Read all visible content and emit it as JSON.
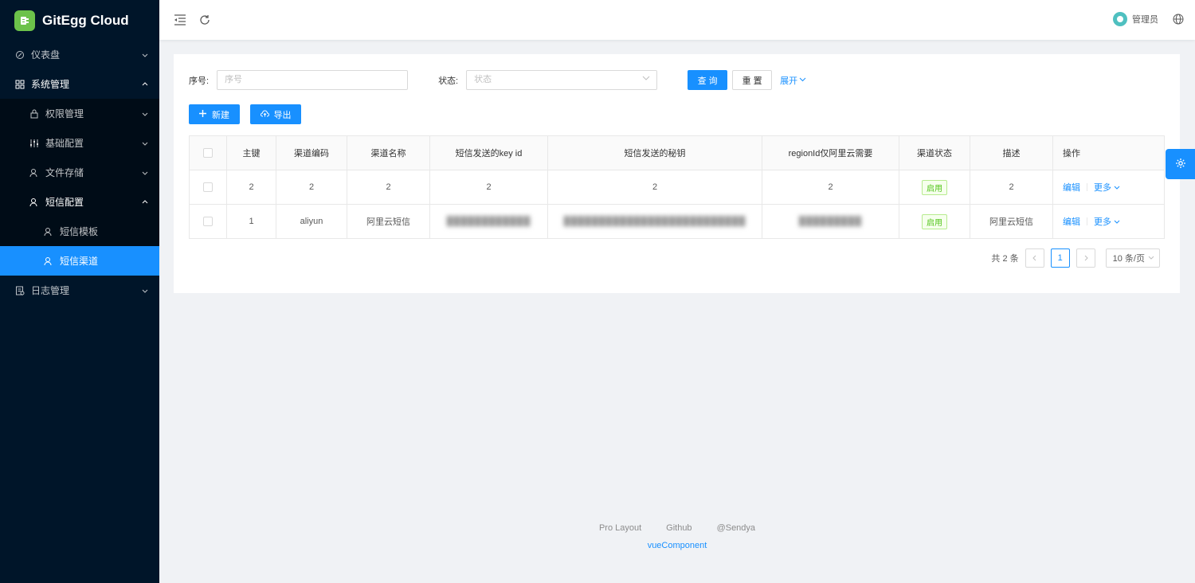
{
  "app": {
    "title": "GitEgg Cloud",
    "accent": "#1890ff",
    "sider_bg": "#001529"
  },
  "sidebar": {
    "items": [
      {
        "label": "仪表盘",
        "icon": "dashboard-icon",
        "arrow": "chevron-down"
      },
      {
        "label": "系统管理",
        "icon": "appstore-icon",
        "arrow": "chevron-up"
      },
      {
        "label": "权限管理",
        "icon": "lock-icon",
        "arrow": "chevron-down"
      },
      {
        "label": "基础配置",
        "icon": "sliders-icon",
        "arrow": "chevron-down"
      },
      {
        "label": "文件存储",
        "icon": "user-icon",
        "arrow": "chevron-down"
      },
      {
        "label": "短信配置",
        "icon": "user-icon",
        "arrow": "chevron-up"
      },
      {
        "label": "短信模板",
        "icon": "user-icon"
      },
      {
        "label": "短信渠道",
        "icon": "user-icon",
        "selected": true
      },
      {
        "label": "日志管理",
        "icon": "log-icon",
        "arrow": "chevron-down"
      }
    ]
  },
  "header": {
    "username": "管理员"
  },
  "search": {
    "seq_label": "序号:",
    "seq_placeholder": "序号",
    "status_label": "状态:",
    "status_placeholder": "状态",
    "query_button": "查 询",
    "reset_button": "重 置",
    "expand_link": "展开"
  },
  "toolbar": {
    "new_button": "新建",
    "export_button": "导出"
  },
  "table": {
    "columns": [
      "主键",
      "渠道编码",
      "渠道名称",
      "短信发送的key id",
      "短信发送的秘钥",
      "regionId仅阿里云需要",
      "渠道状态",
      "描述",
      "操作"
    ],
    "rows": [
      {
        "id": "2",
        "code": "2",
        "name": "2",
        "key_id": "2",
        "secret": "2",
        "region": "2",
        "status": "启用",
        "desc": "2",
        "edit": "编辑",
        "more": "更多"
      },
      {
        "id": "1",
        "code": "aliyun",
        "name": "阿里云短信",
        "key_id": "████████████",
        "secret": "██████████████████████████",
        "region": "█████████",
        "status": "启用",
        "desc": "阿里云短信",
        "edit": "编辑",
        "more": "更多"
      }
    ]
  },
  "pagination": {
    "total_text": "共 2 条",
    "current_page": "1",
    "page_size": "10 条/页"
  },
  "footer": {
    "links": [
      "Pro Layout",
      "Github",
      "@Sendya"
    ],
    "sub": "vueComponent"
  }
}
